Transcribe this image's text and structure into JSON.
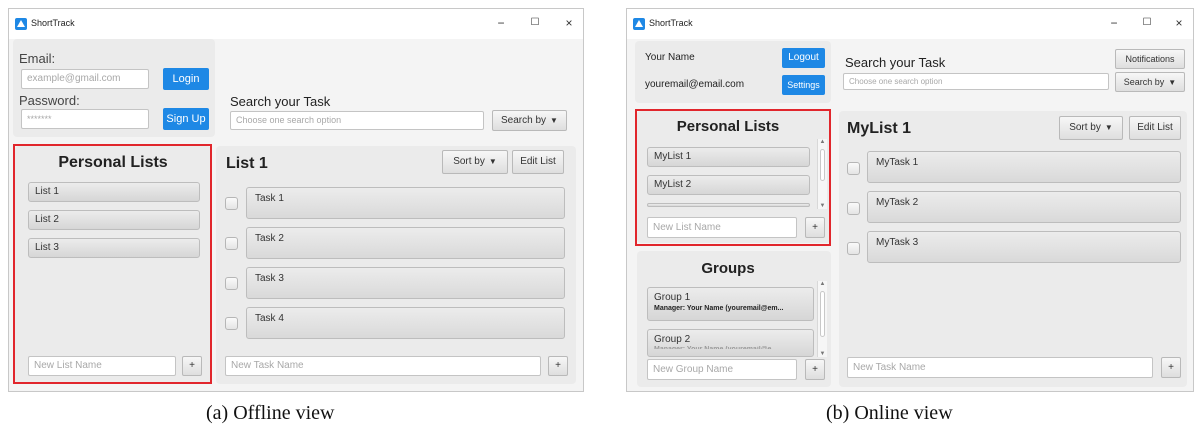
{
  "offline": {
    "app_title": "ShortTrack",
    "login": {
      "email_label": "Email:",
      "email_placeholder": "example@gmail.com",
      "login_label": "Login",
      "password_label": "Password:",
      "password_value": "*******",
      "signup_label": "Sign Up"
    },
    "search": {
      "label": "Search your Task",
      "placeholder": "Choose one search option",
      "search_by_label": "Search by"
    },
    "lists": {
      "heading": "Personal Lists",
      "items": [
        "List 1",
        "List 2",
        "List 3"
      ],
      "new_placeholder": "New List Name",
      "add_label": "+"
    },
    "tasks": {
      "list_title": "List 1",
      "sort_label": "Sort by",
      "edit_label": "Edit List",
      "items": [
        "Task 1",
        "Task 2",
        "Task 3",
        "Task 4"
      ],
      "new_placeholder": "New Task Name",
      "add_label": "+"
    }
  },
  "online": {
    "app_title": "ShortTrack",
    "user": {
      "name": "Your Name",
      "logout_label": "Logout",
      "email": "youremail@email.com",
      "settings_label": "Settings"
    },
    "search": {
      "label": "Search your Task",
      "placeholder": "Choose one search option",
      "notifications_label": "Notifications",
      "search_by_label": "Search by"
    },
    "lists": {
      "heading": "Personal Lists",
      "items": [
        "MyList 1",
        "MyList 2"
      ],
      "new_placeholder": "New List Name",
      "add_label": "+"
    },
    "groups": {
      "heading": "Groups",
      "items": [
        {
          "name": "Group 1",
          "manager": "Manager: Your Name (youremail@em..."
        },
        {
          "name": "Group 2",
          "manager": "Manager: Your Name (youremail@e..."
        }
      ],
      "new_placeholder": "New Group Name",
      "add_label": "+"
    },
    "tasks": {
      "list_title": "MyList 1",
      "sort_label": "Sort by",
      "edit_label": "Edit List",
      "items": [
        "MyTask 1",
        "MyTask 2",
        "MyTask 3"
      ],
      "new_placeholder": "New Task Name",
      "add_label": "+"
    }
  },
  "window_controls": {
    "minimize": "−",
    "maximize": "☐",
    "close": "×"
  },
  "captions": {
    "offline": "(a)  Offline view",
    "online": "(b)  Online view"
  },
  "colors": {
    "accent_blue": "#1e88e5",
    "highlight_red": "#e1262c",
    "panel_gray": "#ebebeb"
  }
}
